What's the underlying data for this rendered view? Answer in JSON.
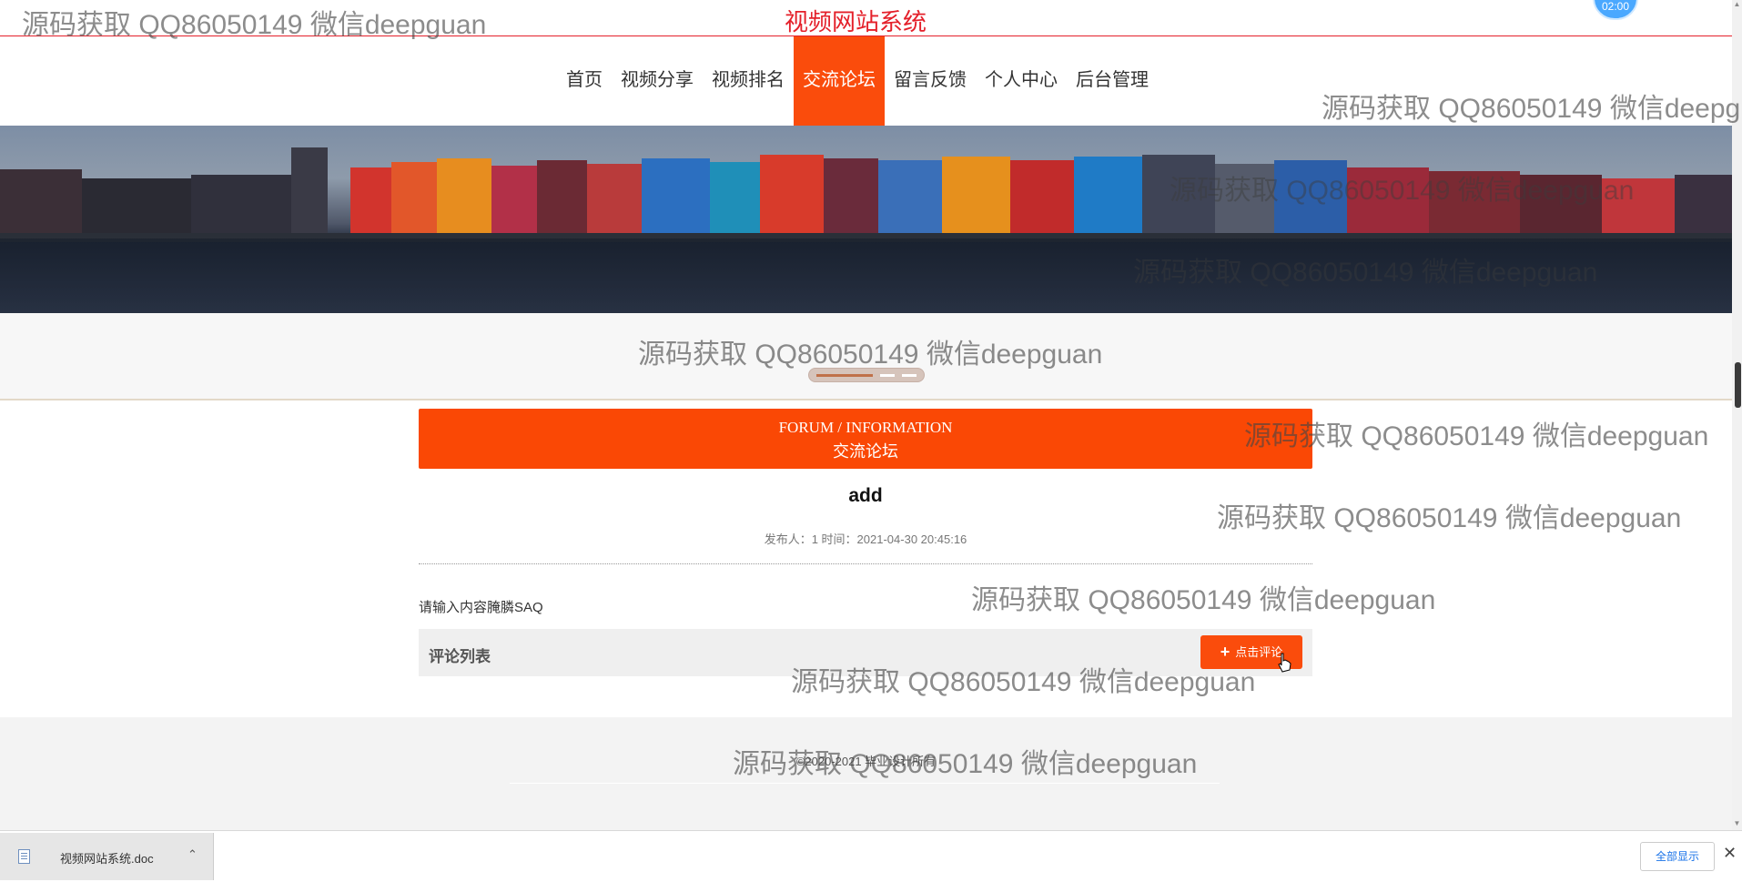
{
  "site_title": "视频网站系统",
  "avatar_text": "02:00",
  "nav": [
    {
      "label": "首页"
    },
    {
      "label": "视频分享"
    },
    {
      "label": "视频排名"
    },
    {
      "label": "交流论坛"
    },
    {
      "label": "留言反馈"
    },
    {
      "label": "个人中心"
    },
    {
      "label": "后台管理"
    }
  ],
  "forum": {
    "header_en": "FORUM / INFORMATION",
    "header_cn": "交流论坛"
  },
  "post": {
    "title": "add",
    "meta": "发布人：1 时间：2021-04-30 20:45:16",
    "content": "请输入内容腌膦SAQ"
  },
  "comments": {
    "label": "评论列表",
    "add_button": "点击评论"
  },
  "footer": {
    "copyright": "©2020-2021 毕业设计所有"
  },
  "download_bar": {
    "file_name": "视频网站系统.doc",
    "show_all": "全部显示"
  },
  "watermark": "源码获取 QQ86050149 微信deepguan",
  "colors": {
    "accent": "#fa4c0c",
    "title_red": "#e4202a"
  }
}
